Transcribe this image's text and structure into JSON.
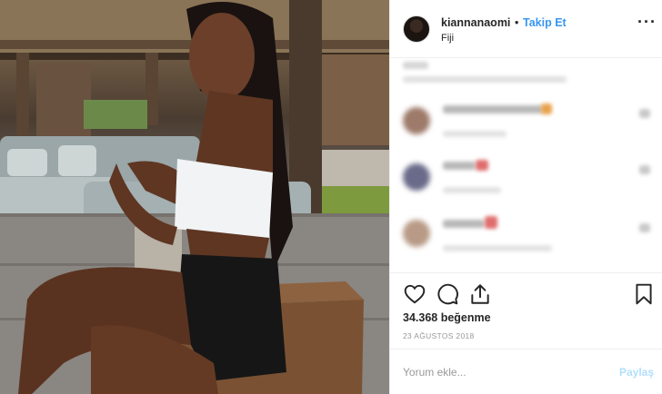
{
  "post": {
    "username": "kiannanaomi",
    "separator": "•",
    "follow_label": "Takip Et",
    "location": "Fiji",
    "more_icon": "more-horizontal-icon",
    "more_label": "···"
  },
  "photo": {
    "description_icon": "post-photo"
  },
  "actions": {
    "like_icon": "heart-icon",
    "comment_icon": "comment-bubble-icon",
    "share_icon": "share-icon",
    "save_icon": "bookmark-icon",
    "likes_text": "34.368 beğenme",
    "date_text": "23 AĞUSTOS 2018"
  },
  "comment_box": {
    "placeholder": "Yorum ekle...",
    "post_label": "Paylaş"
  },
  "colors": {
    "link_blue": "#3897f0",
    "post_disabled": "#b2dffc",
    "border": "#efefef",
    "muted": "#999999"
  }
}
